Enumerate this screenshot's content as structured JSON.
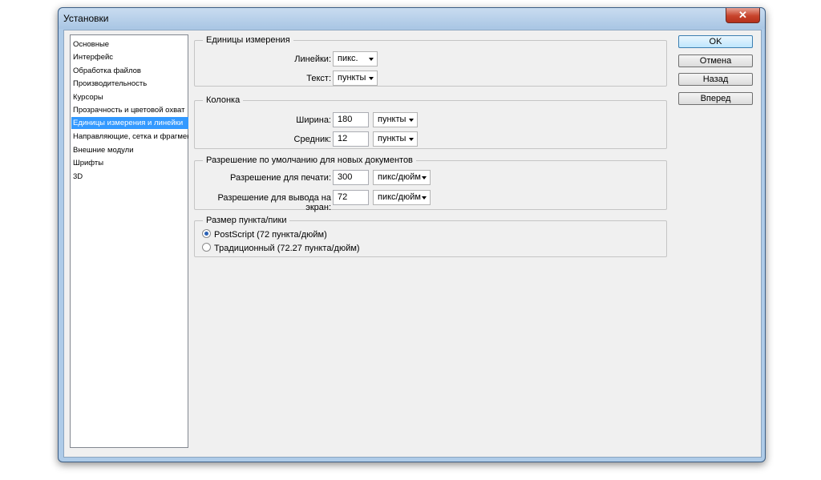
{
  "window": {
    "title": "Установки",
    "close_glyph": "✕"
  },
  "sidebar": {
    "items": [
      {
        "label": "Основные"
      },
      {
        "label": "Интерфейс"
      },
      {
        "label": "Обработка файлов"
      },
      {
        "label": "Производительность"
      },
      {
        "label": "Курсоры"
      },
      {
        "label": "Прозрачность и цветовой охват"
      },
      {
        "label": "Единицы измерения и линейки"
      },
      {
        "label": "Направляющие, сетка и фрагменты"
      },
      {
        "label": "Внешние модули"
      },
      {
        "label": "Шрифты"
      },
      {
        "label": "3D"
      }
    ],
    "selected_index": 6
  },
  "units": {
    "title": "Единицы измерения",
    "rulers_label": "Линейки:",
    "rulers_value": "пикс.",
    "type_label": "Текст:",
    "type_value": "пункты"
  },
  "column": {
    "title": "Колонка",
    "width_label": "Ширина:",
    "width_value": "180",
    "width_unit": "пункты",
    "gutter_label": "Средник:",
    "gutter_value": "12",
    "gutter_unit": "пункты"
  },
  "resolution": {
    "title": "Разрешение по умолчанию для новых документов",
    "print_label": "Разрешение для печати:",
    "print_value": "300",
    "print_unit": "пикс/дюйм",
    "screen_label": "Разрешение для вывода на экран:",
    "screen_value": "72",
    "screen_unit": "пикс/дюйм"
  },
  "point_size": {
    "title": "Размер пункта/пики",
    "postscript_label": "PostScript (72 пункта/дюйм)",
    "traditional_label": "Традиционный (72.27 пункта/дюйм)",
    "selected": "postscript"
  },
  "buttons": {
    "ok": "OK",
    "cancel": "Отмена",
    "back": "Назад",
    "forward": "Вперед"
  }
}
